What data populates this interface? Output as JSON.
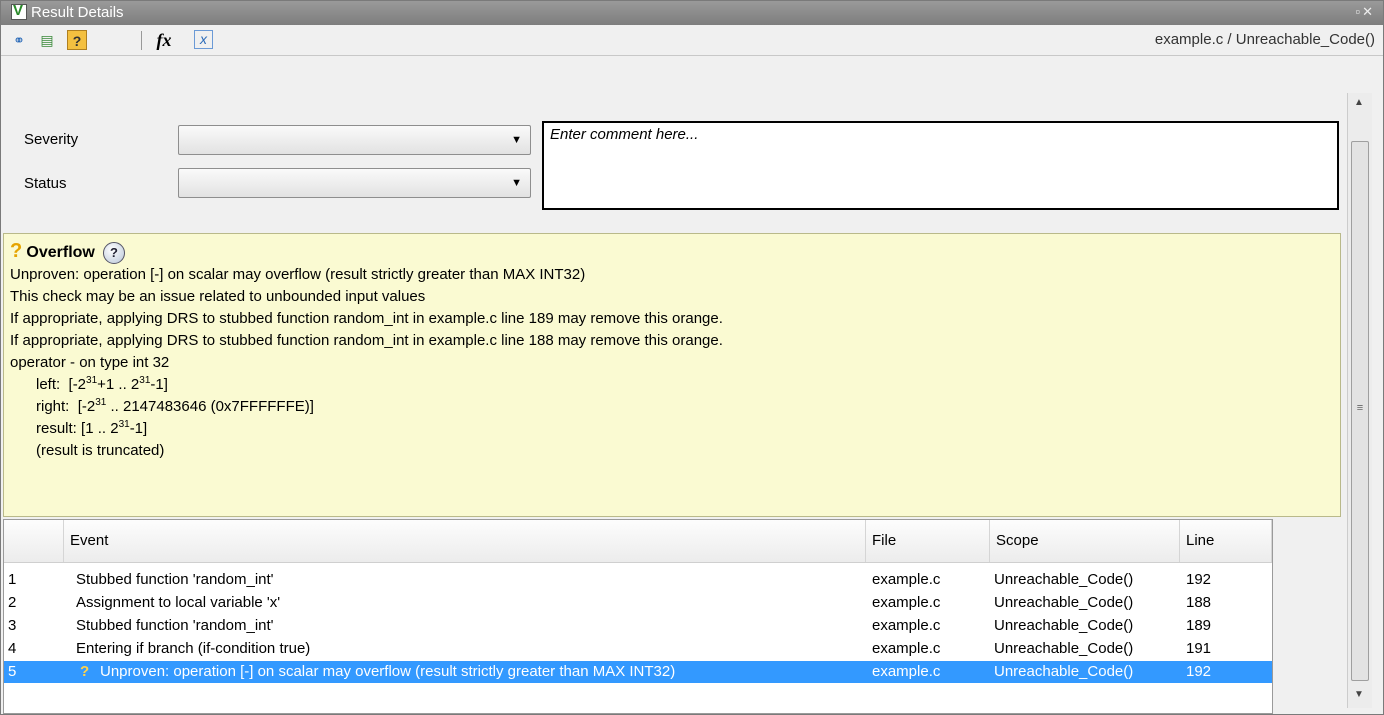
{
  "window": {
    "title": "Result Details",
    "breadcrumb": "example.c / Unreachable_Code()",
    "toolbar_icons": [
      "call-graph-icon",
      "variable-access-icon",
      "help-icon",
      "fx-icon",
      "variable-icon"
    ],
    "fx_label": "fx"
  },
  "review": {
    "severity_label": "Severity",
    "status_label": "Status",
    "severity_value": "",
    "status_value": "",
    "comment_placeholder": "Enter comment here..."
  },
  "details": {
    "check_name": "Overflow",
    "lines": [
      "Unproven: operation [-] on scalar may overflow (result strictly greater than MAX INT32)",
      "This check may be an issue related to unbounded input values",
      "If appropriate, applying DRS to stubbed function random_int in example.c line 189 may remove this orange.",
      "If appropriate, applying DRS to stubbed function random_int in example.c line 188 may remove this orange.",
      "operator - on type int 32"
    ],
    "left_label": "left:",
    "right_label": "right:",
    "result_label": "result:",
    "right_tail": " .. 2147483646 (0x7FFFFFFE)]",
    "truncated_note": "(result is truncated)"
  },
  "events": {
    "columns": [
      "Event",
      "File",
      "Scope",
      "Line"
    ],
    "rows": [
      {
        "n": "1",
        "event": "Stubbed function 'random_int'",
        "file": "example.c",
        "scope": "Unreachable_Code()",
        "line": "192"
      },
      {
        "n": "2",
        "event": "Assignment to local variable 'x'",
        "file": "example.c",
        "scope": "Unreachable_Code()",
        "line": "188"
      },
      {
        "n": "3",
        "event": "Stubbed function 'random_int'",
        "file": "example.c",
        "scope": "Unreachable_Code()",
        "line": "189"
      },
      {
        "n": "4",
        "event": "Entering if branch (if-condition true)",
        "file": "example.c",
        "scope": "Unreachable_Code()",
        "line": "191"
      },
      {
        "n": "5",
        "event": "Unproven: operation [-] on scalar may overflow (result strictly greater than MAX INT32)",
        "file": "example.c",
        "scope": "Unreachable_Code()",
        "line": "192"
      }
    ]
  },
  "colors": {
    "selection": "#3399ff",
    "details_bg": "#fafad2",
    "warning": "#e6a400"
  }
}
